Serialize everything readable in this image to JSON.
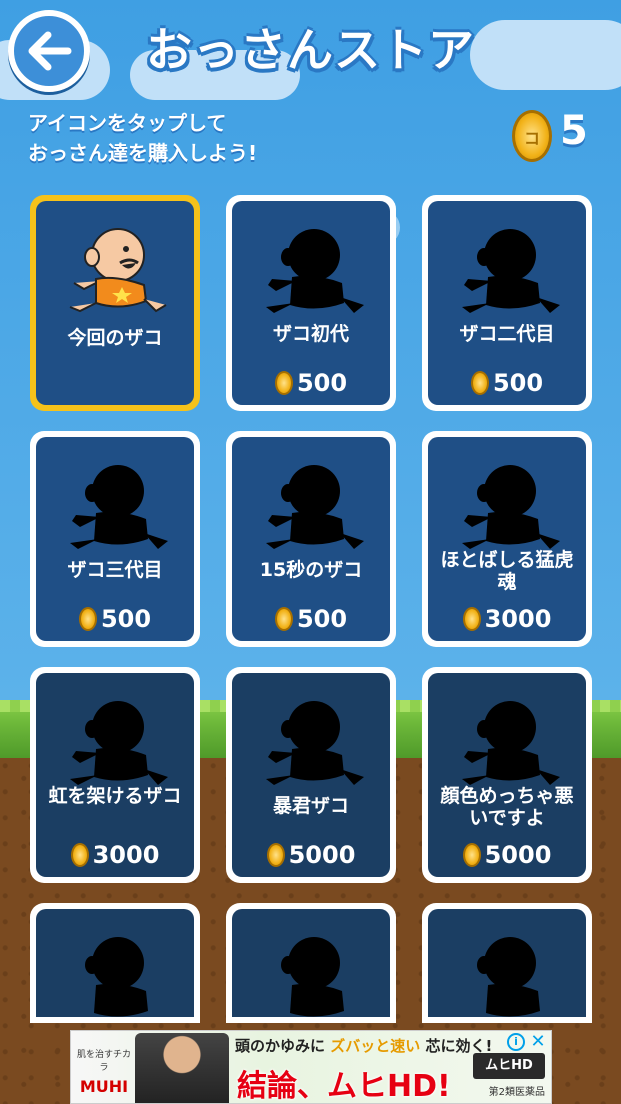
{
  "header": {
    "title": "おっさんストア",
    "back_icon": "arrow-left-icon"
  },
  "instruction": {
    "line1": "アイコンをタップして",
    "line2": "おっさん達を購入しよう!"
  },
  "wallet": {
    "coin_icon": "coin-icon",
    "coin_mark": "コ",
    "coins": "5"
  },
  "store": {
    "items": [
      {
        "name": "今回のザコ",
        "price": "",
        "owned": true,
        "selected": true
      },
      {
        "name": "ザコ初代",
        "price": "500",
        "owned": false
      },
      {
        "name": "ザコ二代目",
        "price": "500",
        "owned": false
      },
      {
        "name": "ザコ三代目",
        "price": "500",
        "owned": false
      },
      {
        "name": "15秒のザコ",
        "price": "500",
        "owned": false
      },
      {
        "name": "ほとばしる猛虎魂",
        "price": "3000",
        "owned": false
      },
      {
        "name": "虹を架けるザコ",
        "price": "3000",
        "owned": false
      },
      {
        "name": "暴君ザコ",
        "price": "5000",
        "owned": false
      },
      {
        "name": "顔色めっちゃ悪いですよ",
        "price": "5000",
        "owned": false
      },
      {
        "name": "",
        "price": "",
        "owned": false
      },
      {
        "name": "",
        "price": "",
        "owned": false
      },
      {
        "name": "",
        "price": "",
        "owned": false
      }
    ]
  },
  "ad": {
    "brand_small": "肌を治すチカラ",
    "brand": "MUHI",
    "headline_a": "頭のかゆみに",
    "headline_b": "ズバッと速い",
    "headline_c": "芯に効く!",
    "main": "結論、ムヒHD!",
    "logo": "ムヒHD",
    "sub": "第2類医薬品",
    "info": "i",
    "close": "✕"
  },
  "colors": {
    "sky": "#4aa5e6",
    "card_frame_selected": "#f6c21a",
    "card_bg": "#1f4f86",
    "coin": "#f2b218"
  }
}
